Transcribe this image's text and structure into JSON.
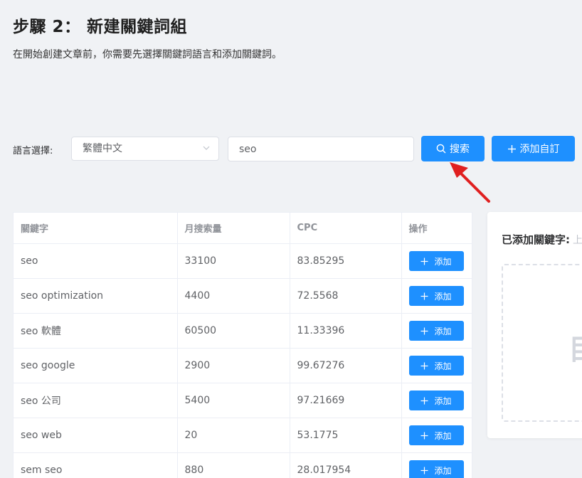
{
  "header": {
    "title": "步驟 2：  新建關鍵詞組",
    "description": "在開始創建文章前，你需要先選擇關鍵詞語言和添加關鍵詞。"
  },
  "search_bar": {
    "language_label": "語言選擇:",
    "language_selected": "繁體中文",
    "keyword_value": "seo",
    "search_button": "搜索",
    "add_custom_button": "添加自訂"
  },
  "table": {
    "columns": [
      "關鍵字",
      "月搜索量",
      "CPC",
      "操作"
    ],
    "add_label": "添加",
    "rows": [
      {
        "keyword": "seo",
        "volume": "33100",
        "cpc": "83.85295"
      },
      {
        "keyword": "seo optimization",
        "volume": "4400",
        "cpc": "72.5568"
      },
      {
        "keyword": "seo 軟體",
        "volume": "60500",
        "cpc": "11.33396"
      },
      {
        "keyword": "seo google",
        "volume": "2900",
        "cpc": "99.67276"
      },
      {
        "keyword": "seo 公司",
        "volume": "5400",
        "cpc": "97.21669"
      },
      {
        "keyword": "seo web",
        "volume": "20",
        "cpc": "53.1775"
      },
      {
        "keyword": "sem seo",
        "volume": "880",
        "cpc": "28.017954"
      }
    ]
  },
  "side_panel": {
    "title": "已添加關鍵字:",
    "hint": "上",
    "empty_text": "目"
  },
  "colors": {
    "primary": "#1e90ff",
    "background": "#f0f2f5",
    "annotation_arrow": "#e02020"
  }
}
